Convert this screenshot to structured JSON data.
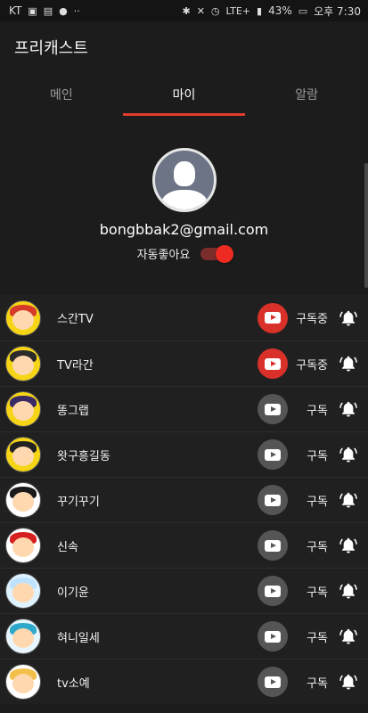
{
  "status_bar": {
    "carrier": "KT",
    "battery": "43%",
    "time": "오후 7:30",
    "network": "LTE+"
  },
  "app": {
    "title": "프리캐스트"
  },
  "tabs": [
    {
      "label": "메인",
      "active": false
    },
    {
      "label": "마이",
      "active": true
    },
    {
      "label": "알람",
      "active": false
    }
  ],
  "profile": {
    "email": "bongbbak2@gmail.com",
    "auto_like_label": "자동좋아요",
    "auto_like_on": true
  },
  "channels": [
    {
      "name": "스간TV",
      "subscribed": true,
      "status": "구독중",
      "avatar_bg": "#f5d516",
      "hair": "#d63b2a"
    },
    {
      "name": "TV라간",
      "subscribed": true,
      "status": "구독중",
      "avatar_bg": "#f5d516",
      "hair": "#2b2b2b"
    },
    {
      "name": "똥그랩",
      "subscribed": false,
      "status": "구독",
      "avatar_bg": "#f5d516",
      "hair": "#3a2a66"
    },
    {
      "name": "왓구흥길동",
      "subscribed": false,
      "status": "구독",
      "avatar_bg": "#f5d516",
      "hair": "#222222"
    },
    {
      "name": "꾸기꾸기",
      "subscribed": false,
      "status": "구독",
      "avatar_bg": "#ffffff",
      "hair": "#1a1a1a"
    },
    {
      "name": "신속",
      "subscribed": false,
      "status": "구독",
      "avatar_bg": "#ffffff",
      "hair": "#d62020"
    },
    {
      "name": "이기윤",
      "subscribed": false,
      "status": "구독",
      "avatar_bg": "#dff2ff",
      "hair": "#bfe3ff"
    },
    {
      "name": "혀니일세",
      "subscribed": false,
      "status": "구독",
      "avatar_bg": "#e8f7ff",
      "hair": "#2fa9c9"
    },
    {
      "name": "tv소예",
      "subscribed": false,
      "status": "구독",
      "avatar_bg": "#ffffff",
      "hair": "#f2c04a"
    }
  ],
  "colors": {
    "accent": "#e33a2f",
    "background": "#1c1c1c"
  }
}
